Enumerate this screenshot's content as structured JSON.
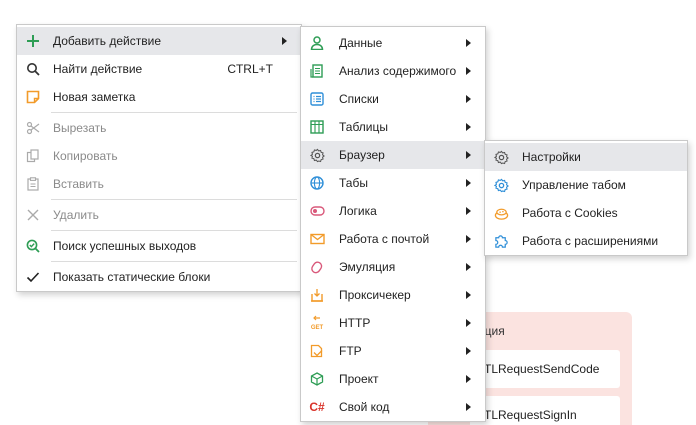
{
  "background": {
    "card_title": "ация",
    "items": [
      "TLRequestSendCode",
      "TLRequestSignIn"
    ]
  },
  "main_menu": {
    "items": [
      {
        "label": "Добавить действие",
        "icon": "plus-icon",
        "has_submenu": true,
        "highlighted": true
      },
      {
        "label": "Найти действие",
        "icon": "search-icon",
        "shortcut": "CTRL+T"
      },
      {
        "label": "Новая заметка",
        "icon": "note-icon"
      },
      {
        "label": "Вырезать",
        "icon": "scissors-icon",
        "disabled": true
      },
      {
        "label": "Копировать",
        "icon": "copy-icon",
        "disabled": true
      },
      {
        "label": "Вставить",
        "icon": "paste-icon",
        "disabled": true
      },
      {
        "label": "Удалить",
        "icon": "close-icon",
        "disabled": true
      },
      {
        "label": "Поиск успешных выходов",
        "icon": "success-search-icon"
      },
      {
        "label": "Показать статические блоки",
        "icon": "checkmark-icon"
      }
    ]
  },
  "submenu_actions": {
    "items": [
      {
        "label": "Данные",
        "icon": "user-icon"
      },
      {
        "label": "Анализ содержимого",
        "icon": "document-analyze-icon"
      },
      {
        "label": "Списки",
        "icon": "list-icon"
      },
      {
        "label": "Таблицы",
        "icon": "table-icon"
      },
      {
        "label": "Браузер",
        "icon": "gear-icon",
        "highlighted": true
      },
      {
        "label": "Табы",
        "icon": "globe-icon"
      },
      {
        "label": "Логика",
        "icon": "toggle-icon"
      },
      {
        "label": "Работа с почтой",
        "icon": "mail-icon"
      },
      {
        "label": "Эмуляция",
        "icon": "mouse-icon"
      },
      {
        "label": "Проксичекер",
        "icon": "proxy-icon"
      },
      {
        "label": "HTTP",
        "icon": "http-get-icon"
      },
      {
        "label": "FTP",
        "icon": "ftp-icon"
      },
      {
        "label": "Проект",
        "icon": "cube-icon"
      },
      {
        "label": "Свой код",
        "icon": "csharp-icon",
        "icon_text": "C#"
      }
    ],
    "http_icon_text": "GET"
  },
  "submenu_browser": {
    "items": [
      {
        "label": "Настройки",
        "icon": "gear-icon",
        "highlighted": true
      },
      {
        "label": "Управление табом",
        "icon": "tab-settings-icon"
      },
      {
        "label": "Работа с Cookies",
        "icon": "cookies-icon"
      },
      {
        "label": "Работа с расширениями",
        "icon": "puzzle-icon"
      }
    ]
  },
  "colors": {
    "green": "#2e9d55",
    "blue": "#2f8fd8",
    "orange": "#f29b2a",
    "red": "#d9342b",
    "pink": "#d9587a",
    "highlight": "#e6e7ea"
  }
}
